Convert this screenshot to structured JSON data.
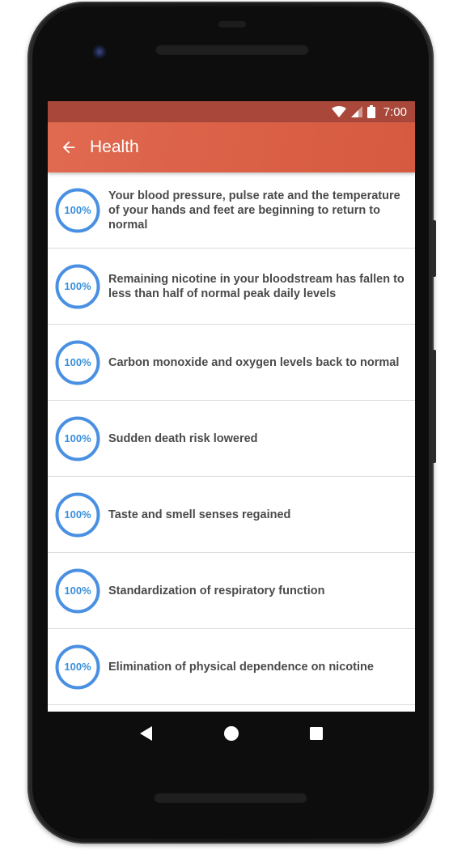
{
  "status_bar": {
    "time": "7:00"
  },
  "app_bar": {
    "title": "Health",
    "back_icon": "arrow-back-icon"
  },
  "accent_color": "#4a90e2",
  "items": [
    {
      "progress": "100%",
      "progress_value": 1.0,
      "text": "Your blood pressure, pulse rate and the temperature of your hands and feet are beginning to return to normal"
    },
    {
      "progress": "100%",
      "progress_value": 1.0,
      "text": "Remaining nicotine in your bloodstream has fallen to less than half of normal peak daily levels"
    },
    {
      "progress": "100%",
      "progress_value": 1.0,
      "text": "Carbon monoxide and oxygen levels back to normal"
    },
    {
      "progress": "100%",
      "progress_value": 1.0,
      "text": "Sudden death risk lowered"
    },
    {
      "progress": "100%",
      "progress_value": 1.0,
      "text": "Taste and smell senses regained"
    },
    {
      "progress": "100%",
      "progress_value": 1.0,
      "text": "Standardization of respiratory function"
    },
    {
      "progress": "100%",
      "progress_value": 1.0,
      "text": "Elimination of physical dependence on nicotine"
    }
  ],
  "nav": {
    "back": "back-icon",
    "home": "home-icon",
    "recents": "recents-icon"
  }
}
